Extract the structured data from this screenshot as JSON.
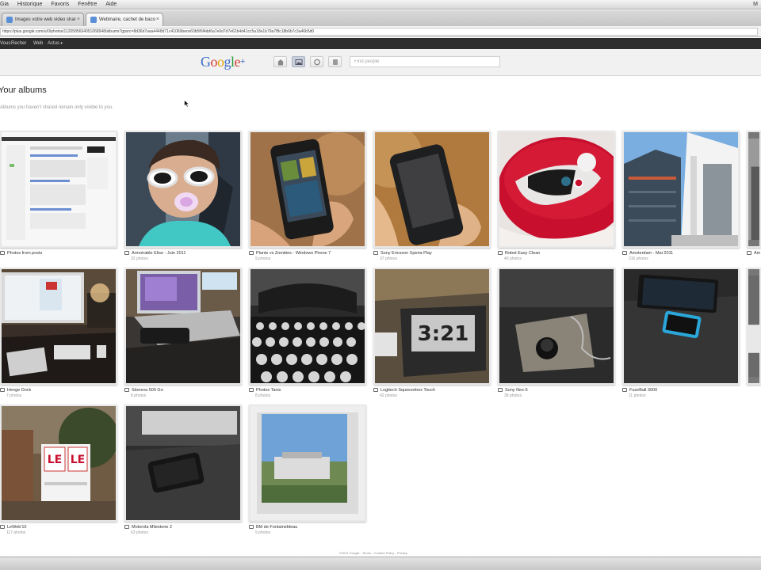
{
  "os_menu": {
    "items": [
      "Gia",
      "Historique",
      "Favoris",
      "Fenêtre",
      "Aide"
    ],
    "right_label": "M"
  },
  "browser": {
    "tabs": [
      {
        "label": "Images votre web video shar",
        "active": false
      },
      {
        "label": "Webinaire, cachet de baco",
        "active": true
      }
    ],
    "url": "https://plus.google.com/u/0/photos/1120585694051068948/albums?gpsrc=8d36d7aaa4448d71c41069bece60b5f6f4dd6a7e6d7d7e62b4d41cc5a18e1b79a7f8c18b6b7c3a46b5d0"
  },
  "gbar": {
    "items": [
      "Vous",
      "Recher",
      "Web",
      "Actus"
    ]
  },
  "header": {
    "logo_text": "Google",
    "logo_plus": "+",
    "search_placeholder": "Find people"
  },
  "page": {
    "title": "Your albums",
    "subtitle": "Albums you haven't shared remain only visible to you."
  },
  "albums": [
    {
      "title": "Photos from posts",
      "count": ""
    },
    {
      "title": "Armoirable Elise - Juin 2011",
      "count": "32 photos"
    },
    {
      "title": "Plants vs Zombies - Windows Phone 7",
      "count": "9 photos"
    },
    {
      "title": "Sony Ericsson Xperia Play",
      "count": "37 photos"
    },
    {
      "title": "Robot Easy Clean",
      "count": "40 photos"
    },
    {
      "title": "Amsterdam - Mai 2011",
      "count": "316 photos"
    },
    {
      "title": "Am",
      "count": ""
    },
    {
      "title": "Henge Dock",
      "count": "7 photos"
    },
    {
      "title": "Stoneva 500 Go",
      "count": "8 photos"
    },
    {
      "title": "Photos Tanis",
      "count": "8 photos"
    },
    {
      "title": "Logitech Squeezebox Touch",
      "count": "42 photos"
    },
    {
      "title": "Sony Nex-5",
      "count": "36 photos"
    },
    {
      "title": "FuseBall 3000",
      "count": "11 photos"
    },
    {
      "title": "",
      "count": ""
    },
    {
      "title": "LeWeb'10",
      "count": "117 photos"
    },
    {
      "title": "Motorola Milestone 2",
      "count": "63 photos"
    },
    {
      "title": "BM de Fontainebleau",
      "count": "9 photos"
    }
  ],
  "clock_text": "3:21",
  "sign_text": "LE",
  "footer": "©2011 Google - Terms - Content Policy - Privacy",
  "colors": {
    "gbar": "#2d2d2d",
    "header": "#f1f1f1",
    "robot_red": "#c8102e",
    "link_blue": "#3f6fc7"
  },
  "icons": {
    "nav_home": "home-icon",
    "nav_photos": "photos-icon",
    "nav_circles": "circles-icon",
    "nav_games": "games-icon",
    "album": "album-icon"
  }
}
